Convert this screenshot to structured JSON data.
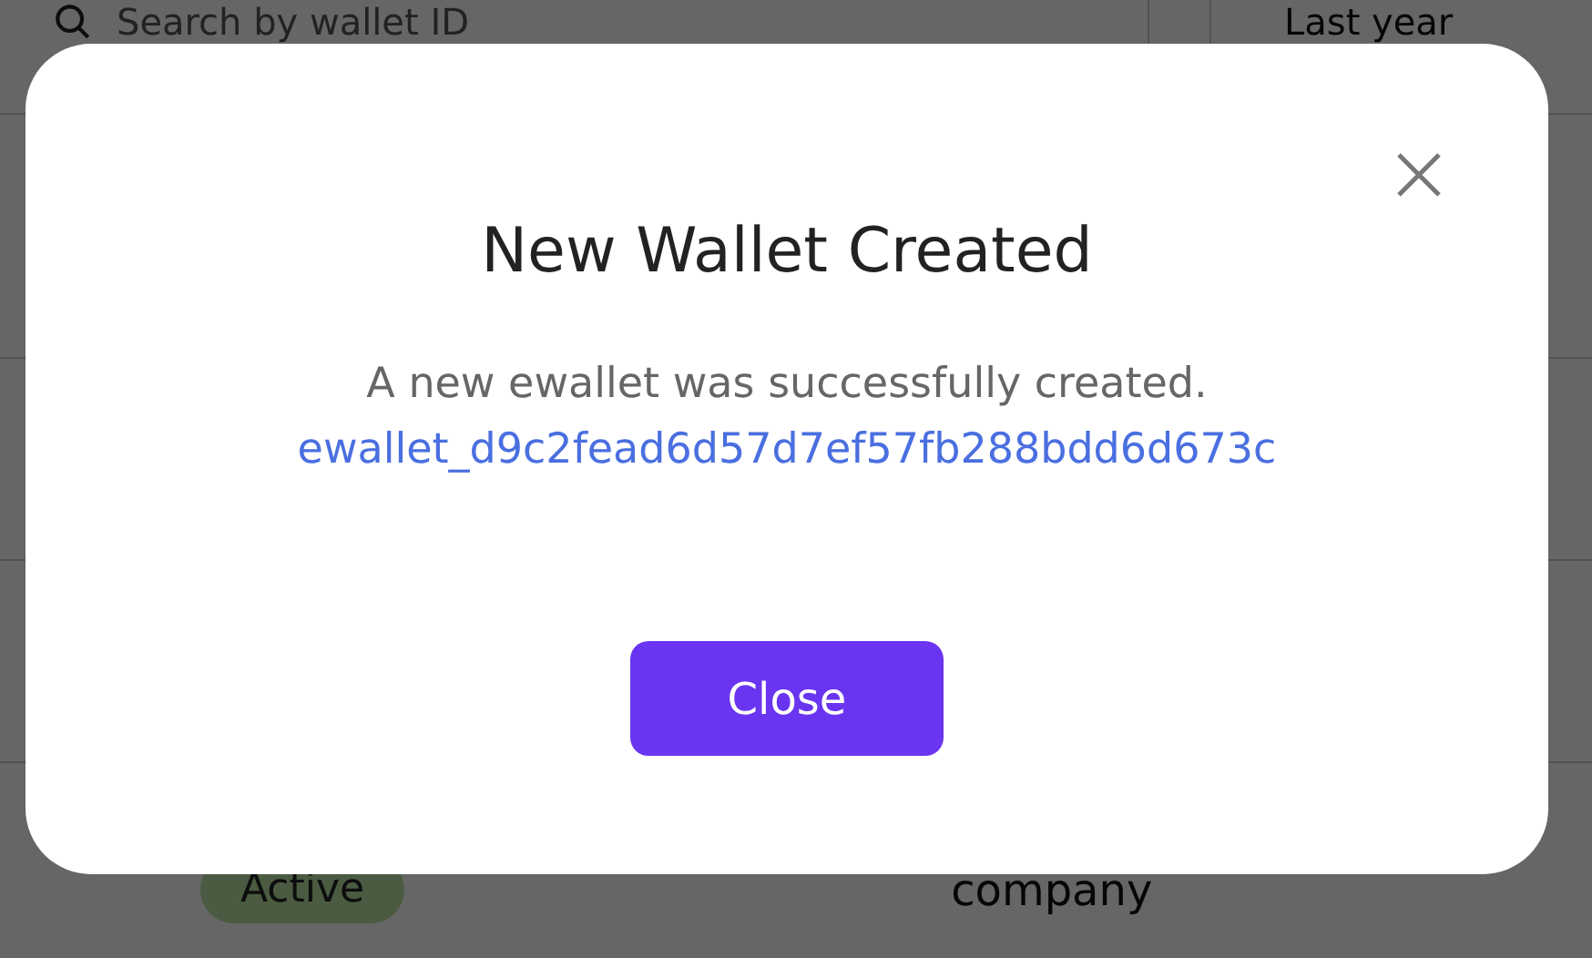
{
  "page": {
    "search": {
      "placeholder": "Search by wallet ID"
    },
    "period": "Last year",
    "row": {
      "status": "Active",
      "type": "company"
    }
  },
  "dialog": {
    "title": "New Wallet Created",
    "message": "A new ewallet was successfully created.",
    "wallet_id": "ewallet_d9c2fead6d57d7ef57fb288bdd6d673c",
    "button": "Close"
  }
}
